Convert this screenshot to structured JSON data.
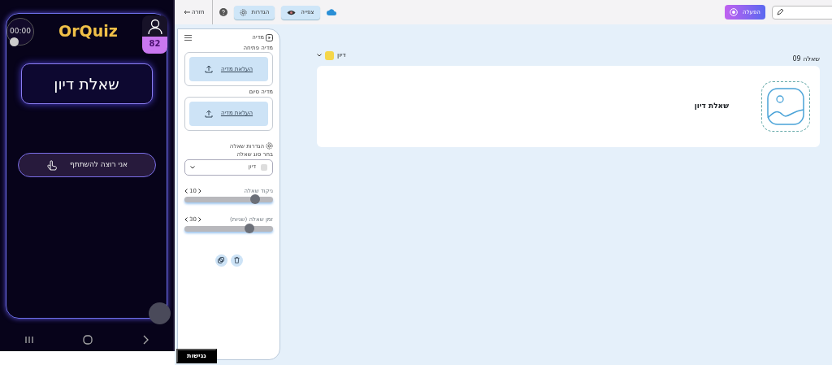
{
  "phone": {
    "logo": "OrQuiz",
    "timer": "00:00",
    "score": "82",
    "question": "שאלת דיון",
    "participate_button": "אני רוצה להשתתף"
  },
  "toolbar": {
    "back": "חזרה",
    "settings": "הגדרות",
    "preview": "צפייה",
    "run": "הפעלה"
  },
  "sidebar": {
    "media_heading": "מדיה",
    "media_slots": [
      {
        "label": "מדיה פתיחה",
        "button": "העלאת מדיה"
      },
      {
        "label": "מדיה סיום",
        "button": "העלאת מדיה"
      }
    ],
    "settings_heading": "הגדרות שאלה",
    "type_label": "בחר סוג שאלה",
    "type_value": "דיון",
    "sliders": [
      {
        "label": "ניקוד שאלה",
        "reading": "10",
        "level": 0.8
      },
      {
        "label": "זמן שאלה (שניות)",
        "reading": "30",
        "level": 0.73
      }
    ]
  },
  "question": {
    "number": "שאלה 09",
    "type": "דיון",
    "text": "שאלת דיון"
  },
  "accessibility_button": "נגישות"
}
